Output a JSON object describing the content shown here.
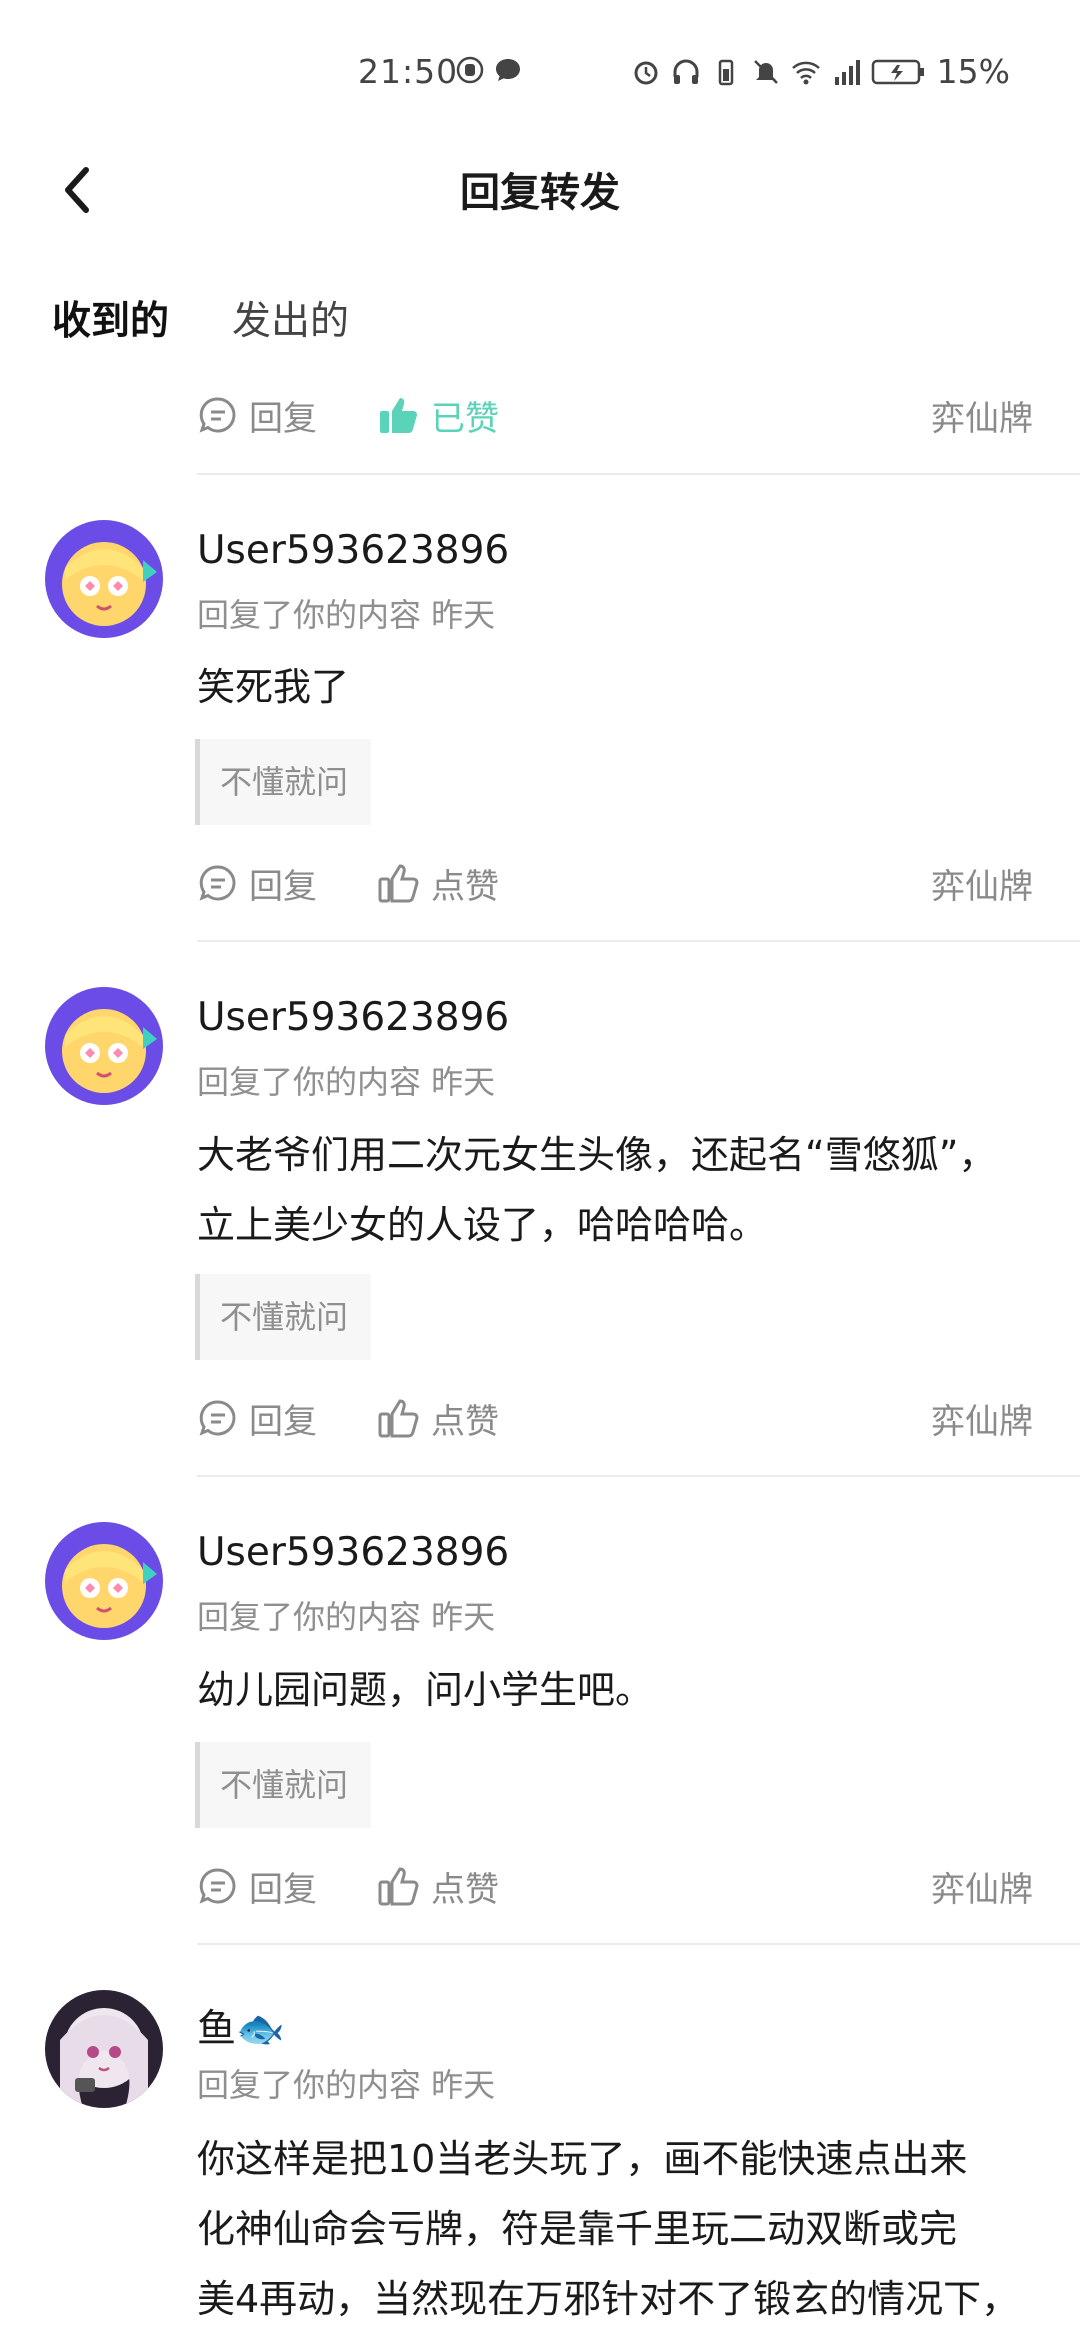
{
  "status_bar": {
    "time": "21:50",
    "battery": "15%"
  },
  "header": {
    "title": "回复转发"
  },
  "tabs": {
    "received": "收到的",
    "sent": "发出的"
  },
  "top_actions": {
    "reply": "回复",
    "liked": "已赞",
    "source": "弈仙牌"
  },
  "comments": [
    {
      "username": "User593623896",
      "meta": "回复了你的内容 昨天",
      "text": "笑死我了",
      "quote": "不懂就问",
      "reply": "回复",
      "like": "点赞",
      "source": "弈仙牌"
    },
    {
      "username": "User593623896",
      "meta": "回复了你的内容 昨天",
      "text_line1": "大老爷们用二次元女生头像，还起名“雪悠狐”，",
      "text_line2": "立上美少女的人设了，哈哈哈哈。",
      "quote": "不懂就问",
      "reply": "回复",
      "like": "点赞",
      "source": "弈仙牌"
    },
    {
      "username": "User593623896",
      "meta": "回复了你的内容 昨天",
      "text": "幼儿园问题，问小学生吧。",
      "quote": "不懂就问",
      "reply": "回复",
      "like": "点赞",
      "source": "弈仙牌"
    },
    {
      "username": "鱼🐟",
      "meta": "回复了你的内容 昨天",
      "text_line1": "你这样是把10当老头玩了，画不能快速点出来",
      "text_line2": "化神仙命会亏牌，符是靠千里玩二动双断或完",
      "text_line3": "美4再动，当然现在万邪针对不了锻玄的情况下，"
    }
  ],
  "colors": {
    "accent": "#5bd3b8",
    "secondary_text": "#8f8f8f",
    "divider": "#ebebeb"
  }
}
